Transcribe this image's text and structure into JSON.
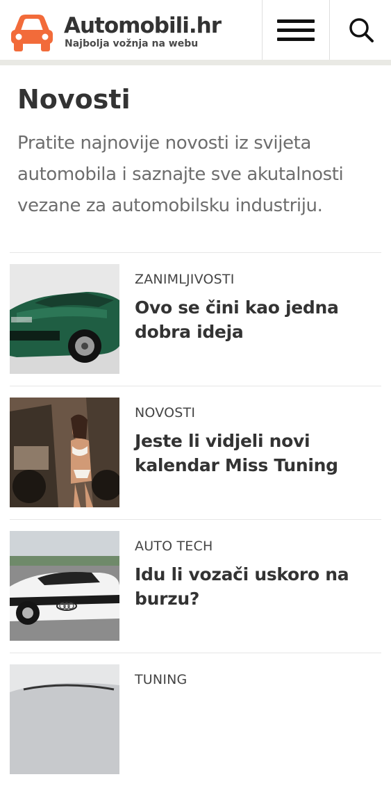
{
  "header": {
    "site_name": "Automobili.hr",
    "tagline": "Najbolja vožnja na webu",
    "logo_icon": "car-icon",
    "menu_icon": "hamburger-menu-icon",
    "search_icon": "search-icon",
    "brand_color": "#f26b3a"
  },
  "intro": {
    "title": "Novosti",
    "description": "Pratite najnovije novosti iz svijeta automobila i saznajte sve akutalnosti vezane za automobilsku industriju."
  },
  "articles": [
    {
      "category": "ZANIMLJIVOSTI",
      "title": "Ovo se čini kao jedna dobra ideja",
      "image": "green-muscle-car"
    },
    {
      "category": "NOVOSTI",
      "title": "Jeste li vidjeli novi kalendar Miss Tuning",
      "image": "calendar-model-offroad-truck"
    },
    {
      "category": "AUTO TECH",
      "title": "Idu li vozači uskoro na burzu?",
      "image": "white-audi-test-car"
    },
    {
      "category": "TUNING",
      "title": "",
      "image": "silver-car"
    }
  ]
}
